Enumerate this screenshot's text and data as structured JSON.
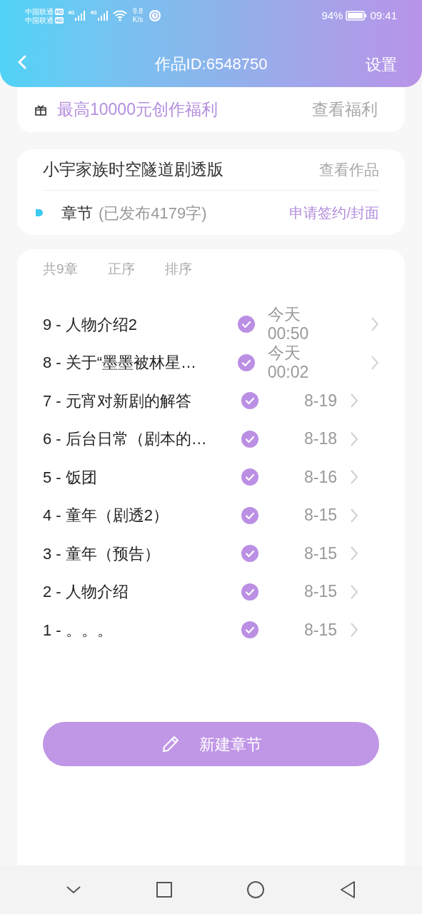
{
  "status_bar": {
    "carriers": [
      {
        "name": "中国联通",
        "badge": "HD"
      },
      {
        "name": "中国联通",
        "badge": "HD"
      }
    ],
    "network": [
      "4G",
      "4G"
    ],
    "speed": "9.8",
    "speed_unit": "K/s",
    "battery": "94%",
    "time": "09:41"
  },
  "header": {
    "title": "作品ID:6548750",
    "action": "设置"
  },
  "promo": {
    "text": "最高10000元创作福利",
    "link": "查看福利"
  },
  "work": {
    "title": "小宇家族时空隧道剧透版",
    "link": "查看作品",
    "section": "章节",
    "section_note": "(已发布4179字)",
    "action": "申请签约/封面"
  },
  "chapters": {
    "count": "共9章",
    "sort_options": [
      "正序",
      "排序"
    ],
    "items": [
      {
        "title": "9 - 人物介绍2",
        "published": true,
        "date": [
          "今天",
          "00:50"
        ]
      },
      {
        "title": "8 - 关于“墨墨被林星…",
        "published": true,
        "date": [
          "今天",
          "00:02"
        ]
      },
      {
        "title": "7 - 元宵对新剧的解答",
        "published": true,
        "date": [
          "8-19"
        ]
      },
      {
        "title": "6 - 后台日常（剧本的…",
        "published": true,
        "date": [
          "8-18"
        ]
      },
      {
        "title": "5 - 饭团",
        "published": true,
        "date": [
          "8-16"
        ]
      },
      {
        "title": "4 - 童年（剧透2）",
        "published": true,
        "date": [
          "8-15"
        ]
      },
      {
        "title": "3 - 童年（预告）",
        "published": true,
        "date": [
          "8-15"
        ]
      },
      {
        "title": "2 - 人物介绍",
        "published": true,
        "date": [
          "8-15"
        ]
      },
      {
        "title": "1 - 。。。",
        "published": true,
        "date": [
          "8-15"
        ]
      }
    ]
  },
  "new_button": "新建章节"
}
